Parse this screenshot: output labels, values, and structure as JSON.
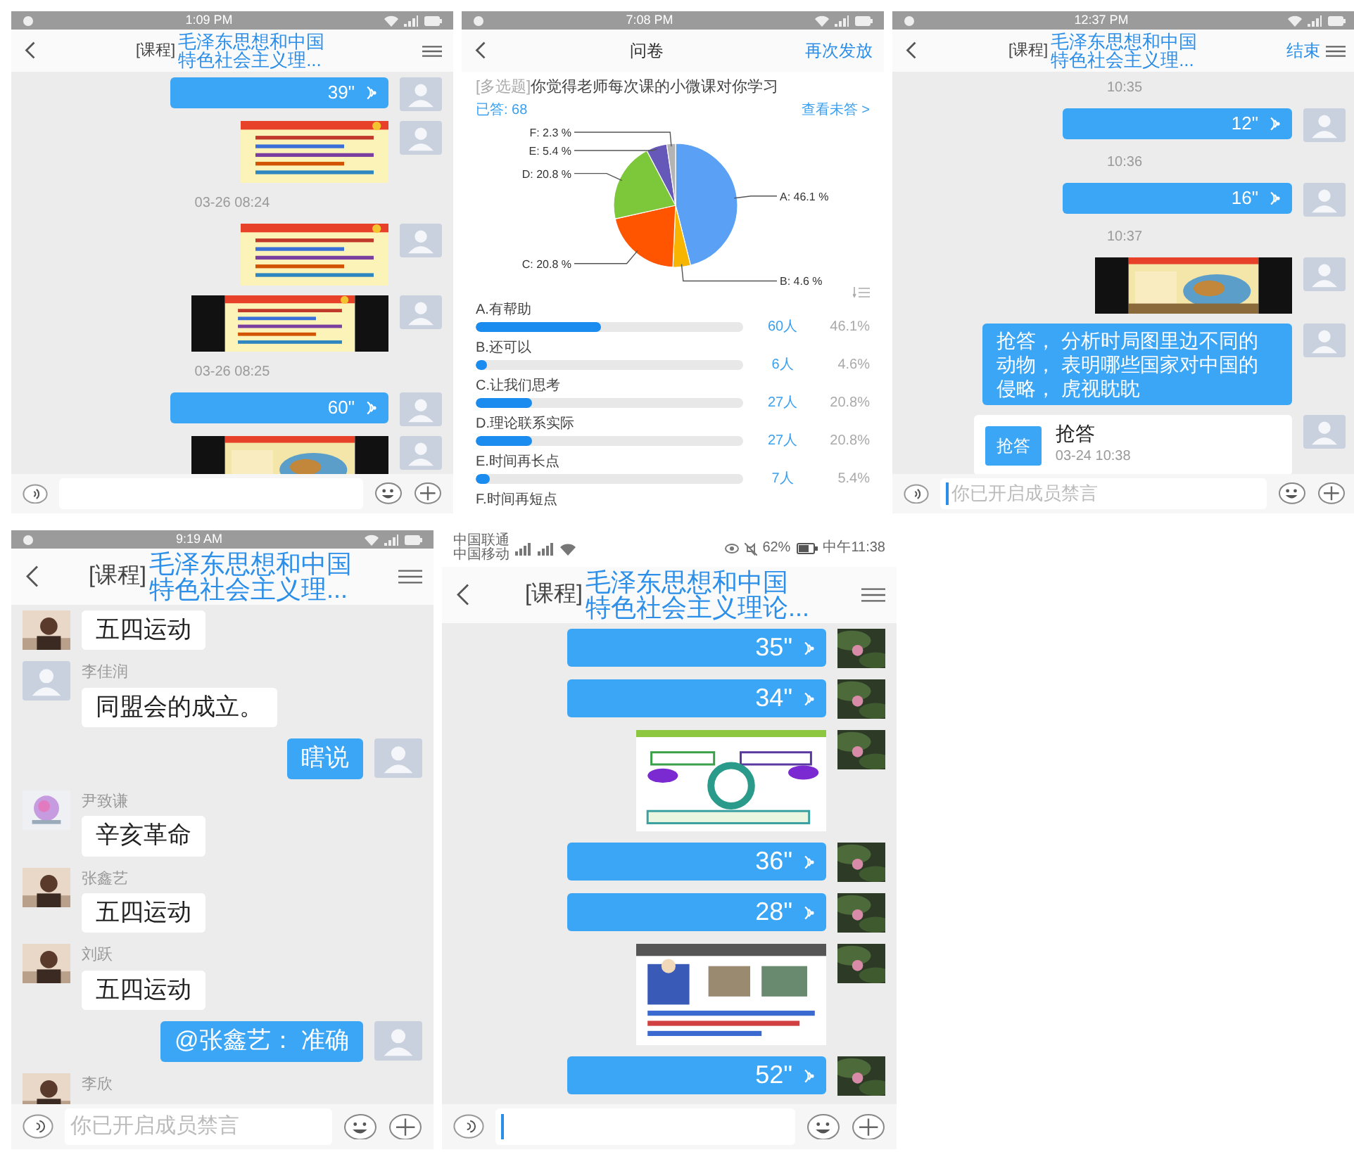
{
  "phones": [
    {
      "kind": "chat",
      "status": {
        "kind": "simple",
        "time": "1:09 PM"
      },
      "header": {
        "prefix": "[课程]",
        "title": [
          "毛泽东思想和中国",
          "特色社会主义理..."
        ]
      },
      "messages": [
        {
          "kind": "voice",
          "duration": "39\"",
          "avatar": {
            "kind": "default"
          }
        },
        {
          "letterbox": false,
          "avatar": {
            "kind": "default"
          }
        },
        {
          "kind": "time",
          "text": "03-26 08:24"
        },
        {
          "letterbox": false,
          "avatar": {
            "kind": "default"
          }
        },
        {
          "letterbox": true,
          "avatar": {
            "kind": "default"
          }
        },
        {
          "kind": "time",
          "text": "03-26 08:25"
        },
        {
          "kind": "voice",
          "duration": "60\"",
          "avatar": {
            "kind": "default"
          }
        },
        {
          "letterbox": true,
          "avatar": {
            "kind": "default"
          }
        }
      ],
      "input": {
        "cursor": false
      }
    },
    {
      "kind": "survey",
      "status": {
        "kind": "simple",
        "time": "7:08 PM"
      },
      "header": {
        "title": "问卷",
        "action": "再次发放"
      },
      "question": {
        "tag": "[多选题]",
        "text": "你觉得老师每次课的小微课对你学习"
      },
      "answered": "已答: 68",
      "unanswered_link": "查看未答 >",
      "chart_data": {
        "type": "pie",
        "values": [
          46.1,
          4.6,
          20.8,
          20.8,
          5.4,
          2.3
        ],
        "colors": [
          "#5aa0f5",
          "#f7b500",
          "#ff5500",
          "#7cc83a",
          "#6558b8",
          "#b4b4b4"
        ],
        "value_labels": [
          "A: 46.1 %",
          "B: 4.6 %",
          "C: 20.8 %",
          "D: 20.8 %",
          "E: 5.4 %",
          "F: 2.3 %"
        ]
      },
      "options": [
        {
          "label": "A.有帮助",
          "count": "60人",
          "percent": "46.1%",
          "level": 0.47
        },
        {
          "label": "B.还可以",
          "count": "6人",
          "percent": "4.6%",
          "level": 0.04
        },
        {
          "label": "C.让我们思考",
          "count": "27人",
          "percent": "20.8%",
          "level": 0.21
        },
        {
          "label": "D.理论联系实际",
          "count": "27人",
          "percent": "20.8%",
          "level": 0.21
        },
        {
          "label": "E.时间再长点",
          "count": "7人",
          "percent": "5.4%",
          "level": 0.055
        },
        {
          "label": "F.时间再短点"
        }
      ]
    },
    {
      "kind": "chat",
      "status": {
        "kind": "simple",
        "time": "12:37 PM"
      },
      "header": {
        "prefix": "[课程]",
        "title": [
          "毛泽东思想和中国",
          "特色社会主义理..."
        ],
        "action": "结束"
      },
      "messages": [
        {
          "kind": "time",
          "text": "10:35"
        },
        {
          "kind": "voice",
          "duration": "12\"",
          "avatar": {
            "kind": "default"
          }
        },
        {
          "kind": "time",
          "text": "10:36"
        },
        {
          "kind": "voice",
          "duration": "16\"",
          "avatar": {
            "kind": "default"
          }
        },
        {
          "kind": "time",
          "text": "10:37"
        },
        {
          "letterbox": true,
          "avatar": {
            "kind": "default"
          }
        },
        {
          "kind": "text",
          "outgoing": true,
          "text": "抢答， 分析时局图里边不同的动物， 表明哪些国家对中国的侵略， 虎视眈眈",
          "avatar": {
            "kind": "default"
          }
        },
        {
          "kind": "card",
          "button": "抢答",
          "title": "抢答",
          "time": "03-24 10:38",
          "avatar": {
            "kind": "default"
          }
        }
      ],
      "input": {
        "placeholder": "你已开启成员禁言",
        "cursor": true
      }
    },
    {
      "kind": "chat",
      "status": {
        "kind": "simple",
        "time": "9:19 AM"
      },
      "header": {
        "prefix": "[课程]",
        "title": [
          "毛泽东思想和中国",
          "特色社会主义理..."
        ]
      },
      "messages": [
        {
          "kind": "text",
          "outgoing": false,
          "text": "五四运动"
        },
        {
          "kind": "text",
          "outgoing": false,
          "sender": "李佳润",
          "text": "同盟会的成立。",
          "avatar": {
            "kind": "default"
          }
        },
        {
          "kind": "text",
          "outgoing": true,
          "text": "瞎说",
          "avatar": {
            "kind": "default"
          }
        },
        {
          "kind": "text",
          "outgoing": false,
          "sender": "尹致谦",
          "text": "辛亥革命"
        },
        {
          "kind": "text",
          "outgoing": false,
          "sender": "张鑫艺",
          "text": "五四运动"
        },
        {
          "kind": "text",
          "outgoing": false,
          "sender": "刘跃",
          "text": "五四运动"
        },
        {
          "kind": "text",
          "outgoing": true,
          "text": "@张鑫艺： 准确",
          "avatar": {
            "kind": "default"
          }
        },
        {
          "kind": "text",
          "outgoing": false,
          "sender": "李欣"
        }
      ],
      "input": {
        "placeholder": "你已开启成员禁言",
        "cursor": false
      }
    },
    {
      "kind": "chat",
      "status": {
        "kind": "detailed",
        "carriers": [
          "中国联通",
          "中国移动"
        ],
        "battery": "62%",
        "time": "中午11:38"
      },
      "header": {
        "prefix": "[课程]",
        "title": [
          "毛泽东思想和中国",
          "特色社会主义理论..."
        ]
      },
      "messages": [
        {
          "kind": "voice",
          "duration": "35\""
        },
        {
          "kind": "voice",
          "duration": "34\""
        },
        {
          "letterbox": false
        },
        {
          "kind": "voice",
          "duration": "36\""
        },
        {
          "kind": "voice",
          "duration": "28\""
        },
        {
          "letterbox": false
        },
        {
          "kind": "voice",
          "duration": "52\""
        }
      ],
      "input": {
        "cursor": true
      }
    }
  ]
}
